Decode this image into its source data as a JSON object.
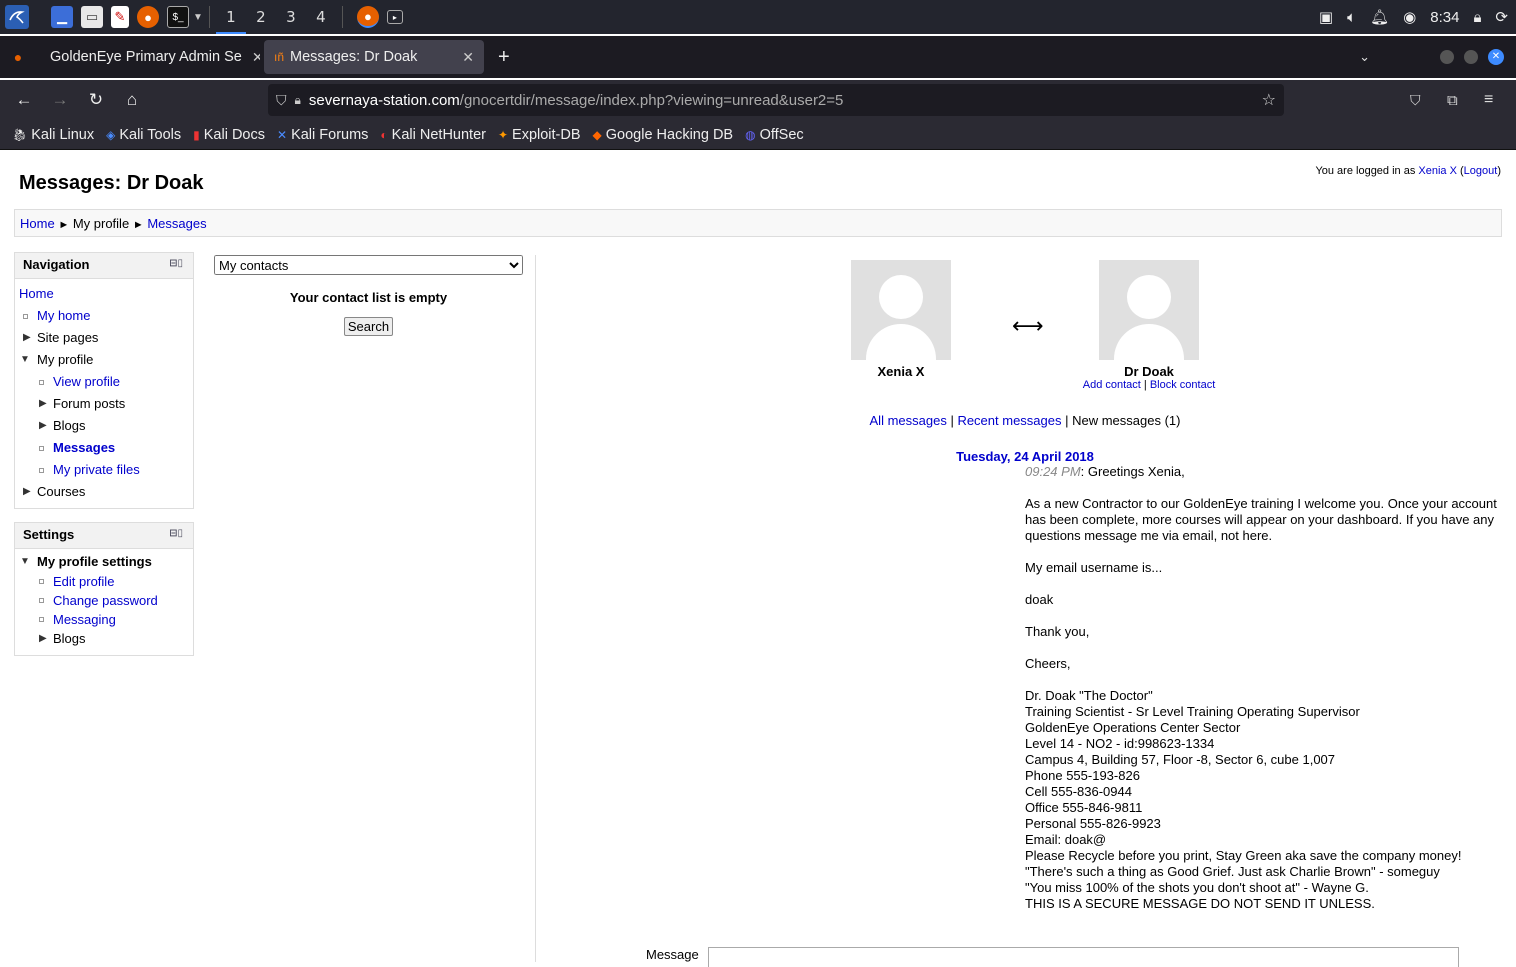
{
  "taskbar": {
    "workspaces": [
      "1",
      "2",
      "3",
      "4"
    ],
    "clock": "8:34"
  },
  "tabs": [
    {
      "label": "GoldenEye Primary Admin Se"
    },
    {
      "label": "Messages: Dr Doak",
      "close": "✕"
    }
  ],
  "url": {
    "domain": "severnaya-station.com",
    "path": "/gnocertdir/message/index.php?viewing=unread&user2=5"
  },
  "bookmarks": [
    "Kali Linux",
    "Kali Tools",
    "Kali Docs",
    "Kali Forums",
    "Kali NetHunter",
    "Exploit-DB",
    "Google Hacking DB",
    "OffSec"
  ],
  "page": {
    "title": "Messages: Dr Doak",
    "login_prefix": "You are logged in as",
    "login_user": "Xenia X",
    "logout": "Logout",
    "breadcrumb": {
      "home": "Home",
      "sep": "►",
      "profile": "My profile",
      "messages": "Messages"
    }
  },
  "navigation": {
    "title": "Navigation",
    "home": "Home",
    "my_home": "My home",
    "site_pages": "Site pages",
    "my_profile": "My profile",
    "view_profile": "View profile",
    "forum_posts": "Forum posts",
    "blogs": "Blogs",
    "messages": "Messages",
    "private_files": "My private files",
    "courses": "Courses"
  },
  "settings": {
    "title": "Settings",
    "profile_settings": "My profile settings",
    "edit_profile": "Edit profile",
    "change_password": "Change password",
    "messaging": "Messaging",
    "blogs": "Blogs"
  },
  "contacts": {
    "select_value": "My contacts",
    "empty": "Your contact list is empty",
    "search": "Search"
  },
  "conversation": {
    "me": "Xenia X",
    "other": "Dr Doak",
    "arrow": "⟷",
    "add_contact": "Add contact",
    "block_contact": "Block contact",
    "all_messages": "All messages",
    "recent_messages": "Recent messages",
    "new_messages": "New messages (1)",
    "date": "Tuesday, 24 April 2018",
    "time": "09:24 PM",
    "first_line": ": Greetings Xenia,",
    "body": "\nAs a new Contractor to our GoldenEye training I welcome you. Once your account has been complete, more courses will appear on your dashboard. If you have any questions message me via email, not here.\n\nMy email username is...\n\ndoak\n\nThank you,\n\nCheers,\n\nDr. Doak \"The Doctor\"\nTraining Scientist - Sr Level Training Operating Supervisor\nGoldenEye Operations Center Sector\nLevel 14 - NO2 - id:998623-1334\nCampus 4, Building 57, Floor -8, Sector 6, cube 1,007\nPhone 555-193-826\nCell 555-836-0944\nOffice 555-846-9811\nPersonal 555-826-9923\nEmail: doak@\nPlease Recycle before you print, Stay Green aka save the company money!\n\"There's such a thing as Good Grief. Just ask Charlie Brown\" - someguy\n\"You miss 100% of the shots you don't shoot at\" - Wayne G.\nTHIS IS A SECURE MESSAGE DO NOT SEND IT UNLESS.",
    "message_label": "Message"
  }
}
